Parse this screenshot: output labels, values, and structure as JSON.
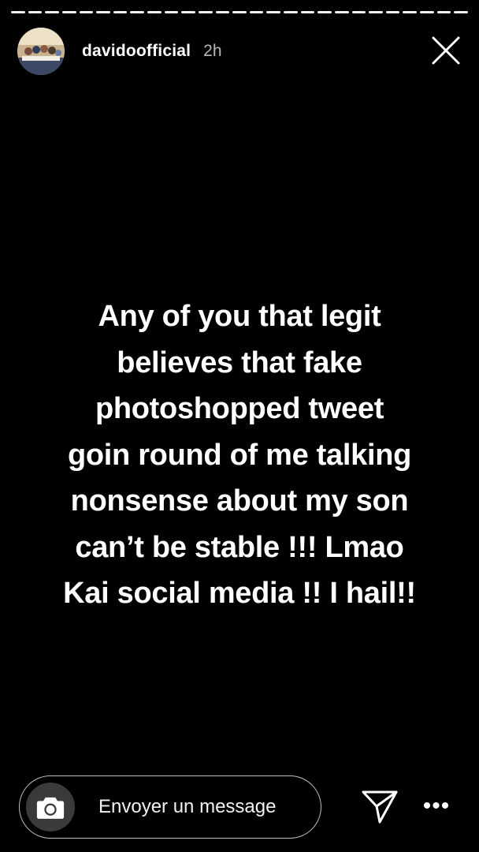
{
  "story": {
    "segments_total": 27,
    "current_segment": 27,
    "user": {
      "username": "davidoofficial",
      "time_ago": "2h",
      "avatar_icon": "profile-photo"
    },
    "text": "Any of you that legit\nbelieves that fake\nphotoshopped tweet\ngoin round of me talking\nnonsense about my son\ncan’t be stable !!! Lmao\nKai social media !! I hail!!",
    "background_color": "#000000",
    "text_color": "#ffffff"
  },
  "reply": {
    "placeholder": "Envoyer un message",
    "camera_icon": "camera-icon",
    "send_icon": "paper-plane-icon",
    "more_icon": "more-dots-icon",
    "more_label": "•••"
  },
  "controls": {
    "close_icon": "close-icon"
  }
}
